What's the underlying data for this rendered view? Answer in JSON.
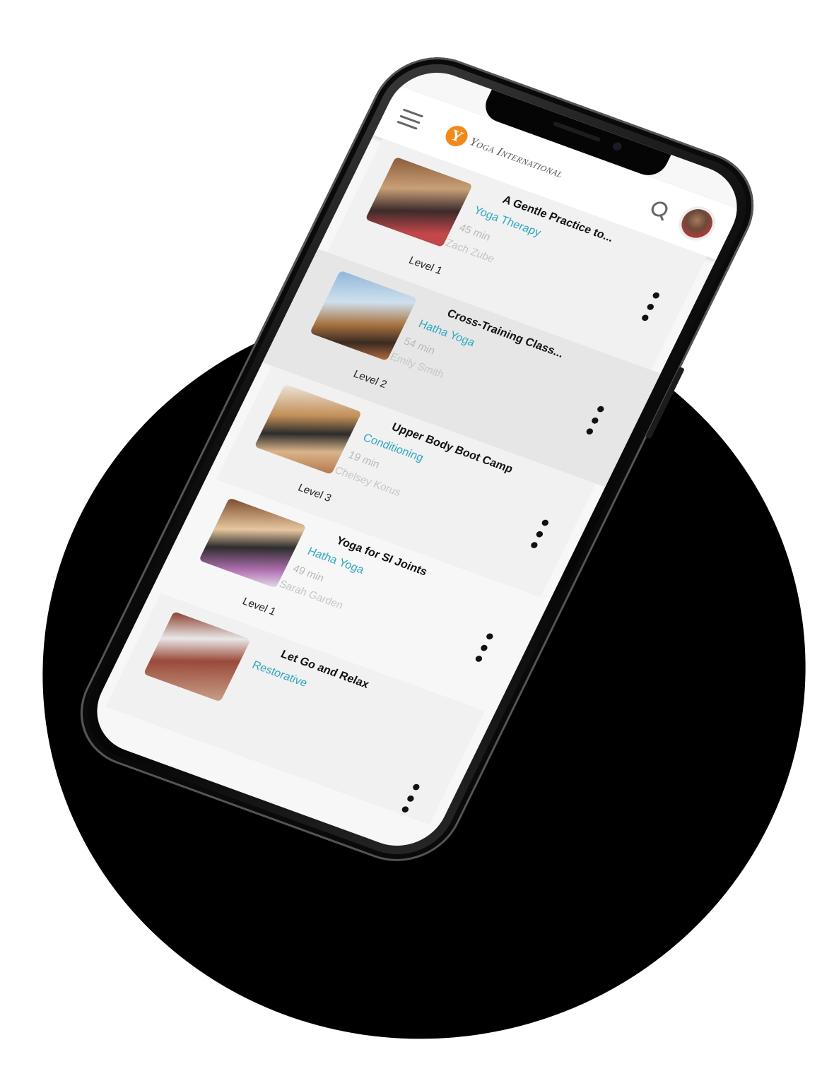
{
  "app": {
    "brand_letter": "Y",
    "brand_name": "Yoga International"
  },
  "colors": {
    "accent": "#2fa8c0",
    "brand": "#f08a1c",
    "phone_body": "#111111"
  },
  "icons": {
    "menu": "hamburger-icon",
    "search": "search-icon",
    "more": "more-vertical-icon"
  },
  "classes": [
    {
      "title": "A Gentle Practice to...",
      "category": "Yoga Therapy",
      "duration": "45 min",
      "instructor": "Zach Zube",
      "level": "Level 1"
    },
    {
      "title": "Cross-Training Class...",
      "category": "Hatha Yoga",
      "duration": "54 min",
      "instructor": "Emily Smith",
      "level": "Level 2"
    },
    {
      "title": "Upper Body Boot Camp",
      "category": "Conditioning",
      "duration": "19 min",
      "instructor": "Chelsey Korus",
      "level": "Level 3"
    },
    {
      "title": "Yoga for SI Joints",
      "category": "Hatha Yoga",
      "duration": "49 min",
      "instructor": "Sarah Garden",
      "level": "Level 1"
    },
    {
      "title": "Let Go and Relax",
      "category": "Restorative",
      "duration": "",
      "instructor": "",
      "level": ""
    }
  ]
}
